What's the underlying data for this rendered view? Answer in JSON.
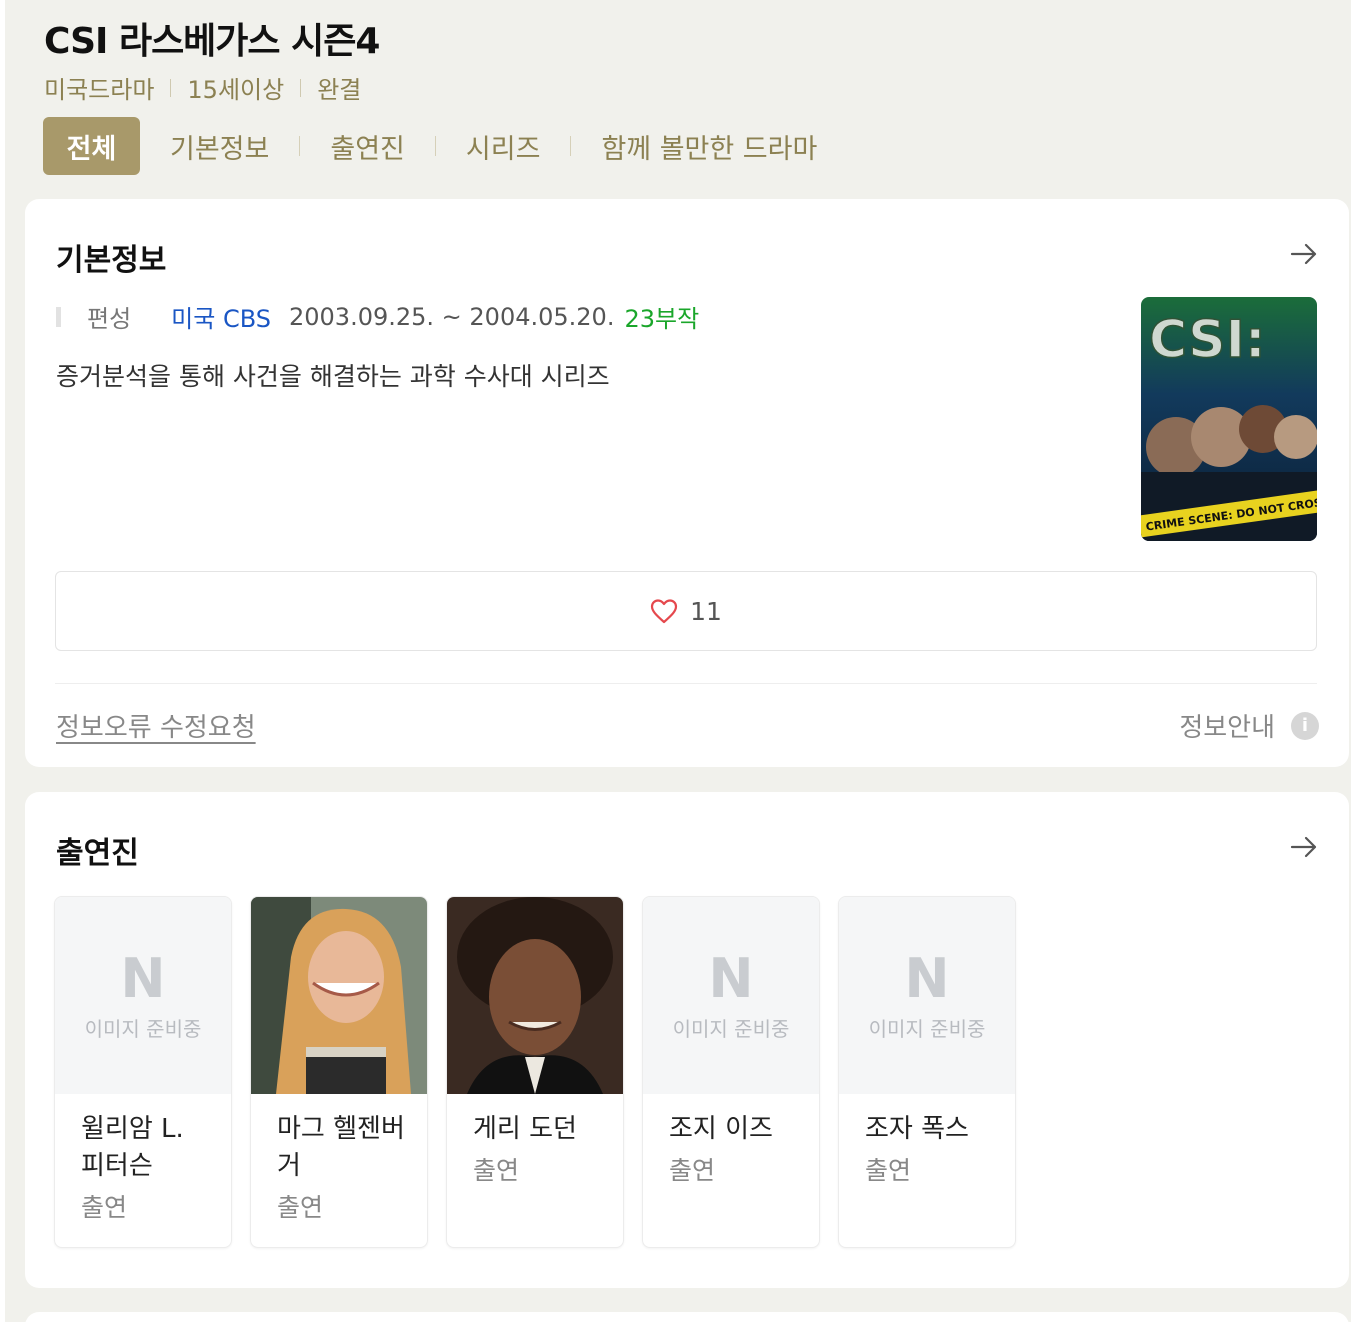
{
  "show": {
    "title": "CSI 라스베가스 시즌4",
    "meta": [
      "미국드라마",
      "15세이상",
      "완결"
    ]
  },
  "tabs": [
    "전체",
    "기본정보",
    "출연진",
    "시리즈",
    "함께 볼만한 드라마"
  ],
  "basic": {
    "heading": "기본정보",
    "label": "편성",
    "broadcaster": "미국 CBS",
    "period": "2003.09.25. ~ 2004.05.20.",
    "episodes": "23부작",
    "description": "증거분석을 통해 사건을 해결하는 과학 수사대 시리즈",
    "likes": "11",
    "report_link": "정보오류 수정요청",
    "guide_link": "정보안내",
    "poster": {
      "logo_text": "CSI:",
      "tape_text": "CRIME SCENE: DO NOT CROSS"
    }
  },
  "cast_section": {
    "heading": "출연진",
    "no_image_logo": "N",
    "no_image_text": "이미지 준비중",
    "members": [
      {
        "name": "윌리암 L. 피터슨",
        "role": "출연",
        "has_photo": false
      },
      {
        "name": "마그 헬젠버거",
        "role": "출연",
        "has_photo": true
      },
      {
        "name": "게리 도던",
        "role": "출연",
        "has_photo": true
      },
      {
        "name": "조지 이즈",
        "role": "출연",
        "has_photo": false
      },
      {
        "name": "조자 폭스",
        "role": "출연",
        "has_photo": false
      }
    ]
  },
  "colors": {
    "accent": "#a8996a",
    "link_blue": "#1a56c4",
    "episodes_green": "#1aa62a",
    "heart": "#e5484d"
  }
}
